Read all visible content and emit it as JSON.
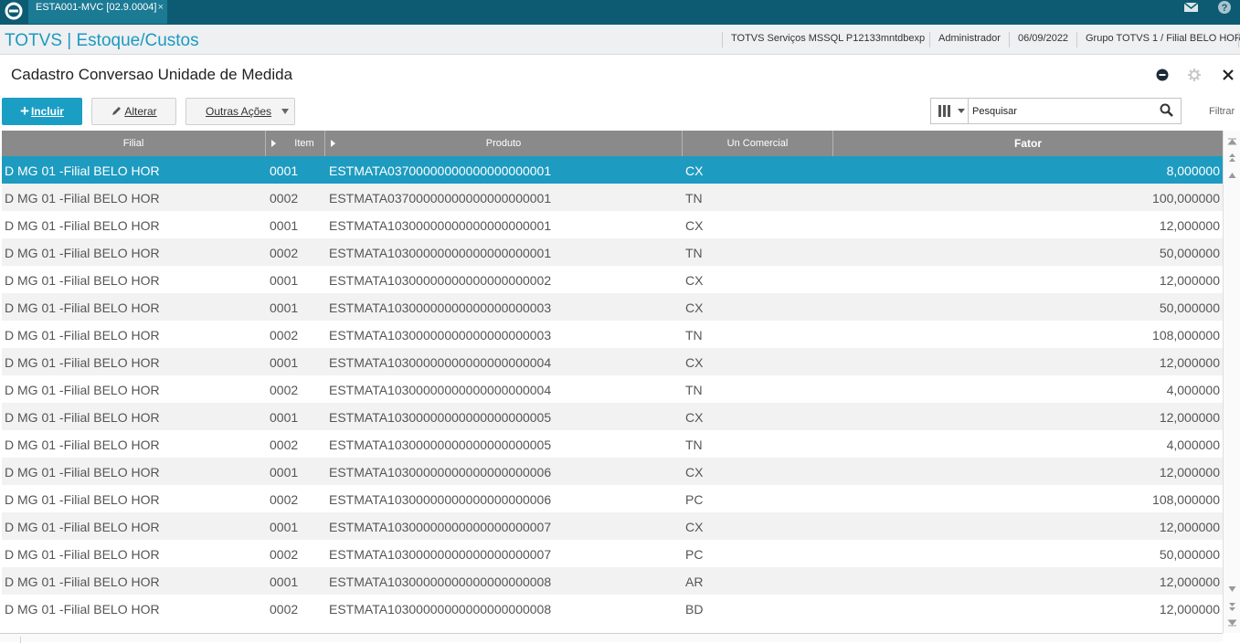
{
  "topbar": {
    "tab_label": "ESTA001-MVC [02.9.0004]",
    "tab_close": "×",
    "colors": {
      "bar": "#0d5b73",
      "tab": "#1b7a94"
    }
  },
  "modbar": {
    "title": "TOTVS | Estoque/Custos",
    "environment": "TOTVS Serviços MSSQL P12133mntdbexp",
    "user": "Administrador",
    "date": "06/09/2022",
    "company": "Grupo TOTVS 1 / Filial BELO HOR"
  },
  "page": {
    "title": "Cadastro Conversao Unidade de Medida"
  },
  "toolbar": {
    "incluir_label": "Incluir",
    "alterar_label": "Alterar",
    "outras_label": "Outras Ações",
    "search_placeholder": "Pesquisar",
    "filtrar_label": "Filtrar",
    "accent_color": "#1b9ec4"
  },
  "grid": {
    "columns": [
      "Filial",
      "Item",
      "Produto",
      "Un Comercial",
      "Fator"
    ],
    "selected_row": 0,
    "rows": [
      {
        "filial": "D MG 01 -Filial BELO HOR",
        "item": "0001",
        "produto": "ESTMATA03700000000000000000001",
        "un": "CX",
        "fator": "8,000000"
      },
      {
        "filial": "D MG 01 -Filial BELO HOR",
        "item": "0002",
        "produto": "ESTMATA03700000000000000000001",
        "un": "TN",
        "fator": "100,000000"
      },
      {
        "filial": "D MG 01 -Filial BELO HOR",
        "item": "0001",
        "produto": "ESTMATA10300000000000000000001",
        "un": "CX",
        "fator": "12,000000"
      },
      {
        "filial": "D MG 01 -Filial BELO HOR",
        "item": "0002",
        "produto": "ESTMATA10300000000000000000001",
        "un": "TN",
        "fator": "50,000000"
      },
      {
        "filial": "D MG 01 -Filial BELO HOR",
        "item": "0001",
        "produto": "ESTMATA10300000000000000000002",
        "un": "CX",
        "fator": "12,000000"
      },
      {
        "filial": "D MG 01 -Filial BELO HOR",
        "item": "0001",
        "produto": "ESTMATA10300000000000000000003",
        "un": "CX",
        "fator": "50,000000"
      },
      {
        "filial": "D MG 01 -Filial BELO HOR",
        "item": "0002",
        "produto": "ESTMATA10300000000000000000003",
        "un": "TN",
        "fator": "108,000000"
      },
      {
        "filial": "D MG 01 -Filial BELO HOR",
        "item": "0001",
        "produto": "ESTMATA10300000000000000000004",
        "un": "CX",
        "fator": "12,000000"
      },
      {
        "filial": "D MG 01 -Filial BELO HOR",
        "item": "0002",
        "produto": "ESTMATA10300000000000000000004",
        "un": "TN",
        "fator": "4,000000"
      },
      {
        "filial": "D MG 01 -Filial BELO HOR",
        "item": "0001",
        "produto": "ESTMATA10300000000000000000005",
        "un": "CX",
        "fator": "12,000000"
      },
      {
        "filial": "D MG 01 -Filial BELO HOR",
        "item": "0002",
        "produto": "ESTMATA10300000000000000000005",
        "un": "TN",
        "fator": "4,000000"
      },
      {
        "filial": "D MG 01 -Filial BELO HOR",
        "item": "0001",
        "produto": "ESTMATA10300000000000000000006",
        "un": "CX",
        "fator": "12,000000"
      },
      {
        "filial": "D MG 01 -Filial BELO HOR",
        "item": "0002",
        "produto": "ESTMATA10300000000000000000006",
        "un": "PC",
        "fator": "108,000000"
      },
      {
        "filial": "D MG 01 -Filial BELO HOR",
        "item": "0001",
        "produto": "ESTMATA10300000000000000000007",
        "un": "CX",
        "fator": "12,000000"
      },
      {
        "filial": "D MG 01 -Filial BELO HOR",
        "item": "0002",
        "produto": "ESTMATA10300000000000000000007",
        "un": "PC",
        "fator": "50,000000"
      },
      {
        "filial": "D MG 01 -Filial BELO HOR",
        "item": "0001",
        "produto": "ESTMATA10300000000000000000008",
        "un": "AR",
        "fator": "12,000000"
      },
      {
        "filial": "D MG 01 -Filial BELO HOR",
        "item": "0002",
        "produto": "ESTMATA10300000000000000000008",
        "un": "BD",
        "fator": "12,000000"
      }
    ]
  }
}
